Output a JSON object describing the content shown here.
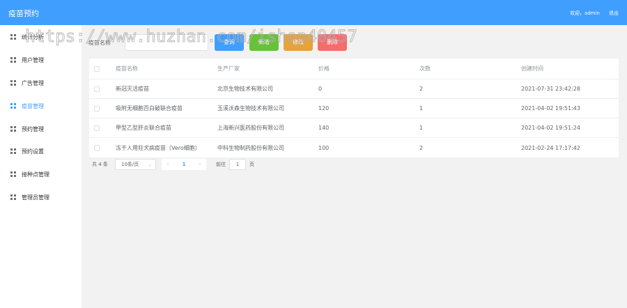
{
  "header": {
    "title": "疫苗预约",
    "welcome": "欢迎，admin",
    "logout": "退出",
    "color": "#409eff"
  },
  "sidebar": {
    "items": [
      {
        "label": "统计分析",
        "active": false
      },
      {
        "label": "用户管理",
        "active": false
      },
      {
        "label": "广告管理",
        "active": false
      },
      {
        "label": "疫苗管理",
        "active": true
      },
      {
        "label": "预约管理",
        "active": false
      },
      {
        "label": "预约设置",
        "active": false
      },
      {
        "label": "接种点管理",
        "active": false
      },
      {
        "label": "管理员管理",
        "active": false
      }
    ]
  },
  "search": {
    "label": "疫苗名称",
    "placeholder": "",
    "buttons": {
      "query": "查询",
      "add": "新增",
      "edit": "修改",
      "delete": "删除"
    }
  },
  "table": {
    "columns": [
      "疫苗名称",
      "生产厂家",
      "价格",
      "次数",
      "创建时间"
    ],
    "rows": [
      {
        "name": "新冠灭活疫苗",
        "maker": "北京生物技术有限公司",
        "price": "0",
        "count": "2",
        "time": "2021-07-31 23:42:28"
      },
      {
        "name": "吸附无细胞百白破联合疫苗",
        "maker": "玉溪沃森生物技术有限公司",
        "price": "120",
        "count": "1",
        "time": "2021-04-02 19:51:43"
      },
      {
        "name": "甲型乙型肝炎联合疫苗",
        "maker": "上海新兴医药股份有限公司",
        "price": "140",
        "count": "1",
        "time": "2021-04-02 19:51:24"
      },
      {
        "name": "冻干人用狂犬病疫苗（Vero细胞）",
        "maker": "中科生物制药股份有限公司",
        "price": "100",
        "count": "2",
        "time": "2021-02-24 17:17:42"
      }
    ]
  },
  "pagination": {
    "total": "共 4 条",
    "page_size": "10条/页",
    "current_page": "1",
    "goto_label": "前往",
    "goto_value": "1",
    "page_unit": "页"
  },
  "watermark": "https://www.huzhan.com/ishop40457"
}
